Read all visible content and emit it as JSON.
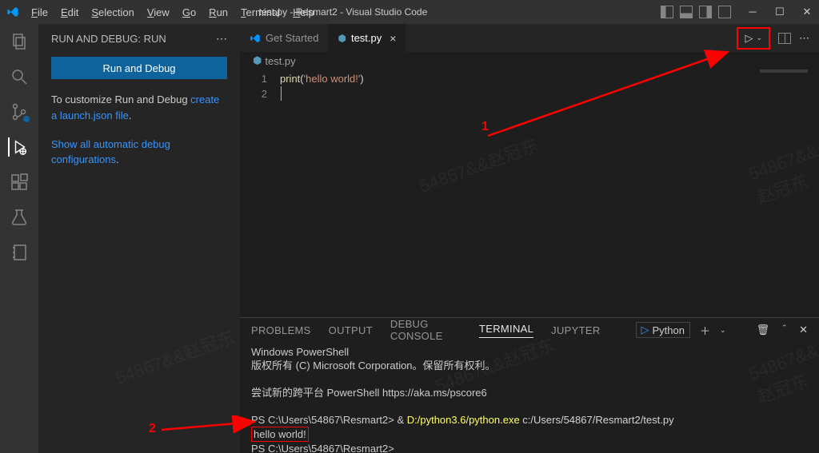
{
  "titlebar": {
    "title": "test.py - Resmart2 - Visual Studio Code"
  },
  "menu": {
    "file": "File",
    "edit": "Edit",
    "selection": "Selection",
    "view": "View",
    "go": "Go",
    "run": "Run",
    "terminal": "Terminal",
    "help": "Help"
  },
  "sidebar": {
    "title": "RUN AND DEBUG: RUN",
    "run_button": "Run and Debug",
    "customize_pre": "To customize Run and Debug ",
    "customize_link": "create a launch.json file",
    "showall_link": "Show all automatic debug configurations",
    "period": "."
  },
  "tabs": {
    "get_started": "Get Started",
    "file": "test.py"
  },
  "breadcrumb": {
    "file": "test.py"
  },
  "code": {
    "lines": [
      "1",
      "2"
    ],
    "line1_kw": "print",
    "line1_open": "(",
    "line1_str": "'hello world!'",
    "line1_close": ")"
  },
  "panel": {
    "problems": "Problems",
    "output": "Output",
    "debug_console": "Debug Console",
    "terminal": "Terminal",
    "jupyter": "Jupyter",
    "shell": "Python"
  },
  "terminal": {
    "l1": "Windows PowerShell",
    "l2": "版权所有 (C) Microsoft Corporation。保留所有权利。",
    "l3": "尝试新的跨平台 PowerShell https://aka.ms/pscore6",
    "p1_prompt": "PS C:\\Users\\54867\\Resmart2> ",
    "p1_amp": "& ",
    "p1_exe": "D:/python3.6/python.exe",
    "p1_arg": " c:/Users/54867/Resmart2/test.py",
    "out": "hello world!",
    "p2_prompt": "PS C:\\Users\\54867\\Resmart2> "
  },
  "annotations": {
    "n1": "1",
    "n2": "2"
  },
  "watermark": "54867&&赵冠东"
}
